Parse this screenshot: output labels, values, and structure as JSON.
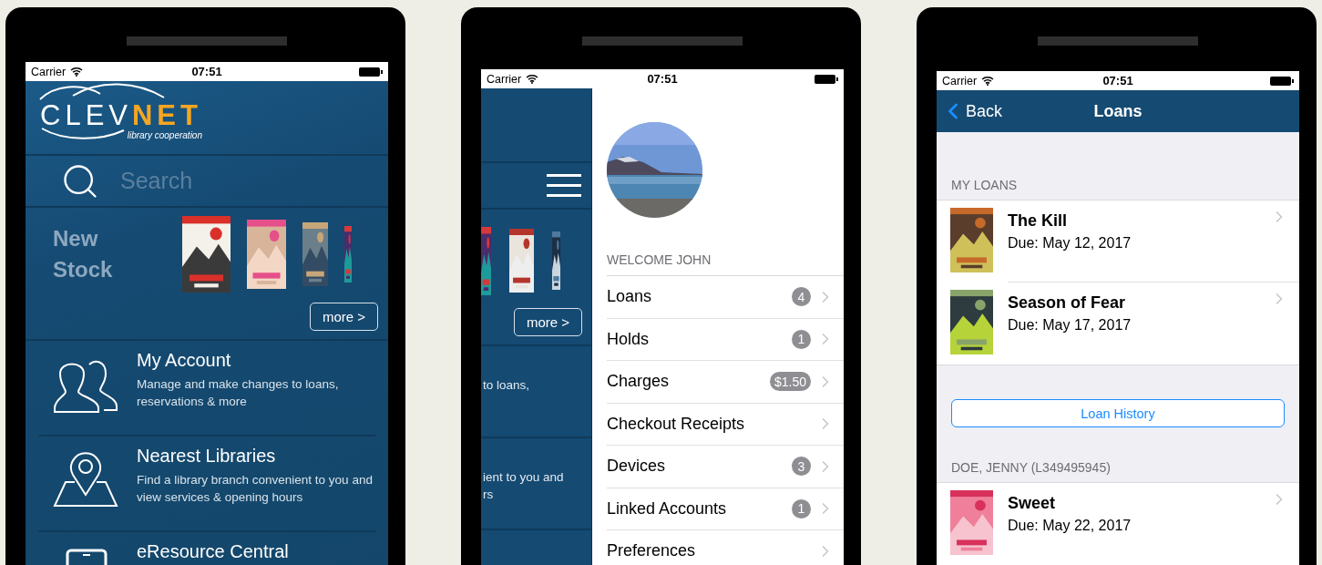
{
  "phones": [
    {
      "kind": "home",
      "status": {
        "carrier": "Carrier",
        "time": "07:51"
      },
      "logo": {
        "main": "CLEV",
        "accent": "NET",
        "tagline": "library cooperation"
      },
      "search": {
        "placeholder": "Search"
      },
      "new_stock": {
        "title": "New Stock",
        "more": "more >"
      },
      "menu": [
        {
          "title": "My Account",
          "description": "Manage and make changes to loans, reservations & more"
        },
        {
          "title": "Nearest Libraries",
          "description": "Find a library branch convenient to you and view services & opening hours"
        },
        {
          "title": "eResource Central"
        }
      ]
    },
    {
      "kind": "drawer",
      "status": {
        "carrier": "Carrier",
        "time": "07:51"
      },
      "behind": {
        "more": "more >",
        "first_lines": [
          "to loans,"
        ],
        "second_lines": [
          "ient to you and",
          "rs"
        ]
      },
      "welcome": "WELCOME JOHN",
      "items": [
        {
          "label": "Loans",
          "badge": "4"
        },
        {
          "label": "Holds",
          "badge": "1"
        },
        {
          "label": "Charges",
          "badge": "$1.50"
        },
        {
          "label": "Checkout Receipts"
        },
        {
          "label": "Devices",
          "badge": "3"
        },
        {
          "label": "Linked Accounts",
          "badge": "1"
        },
        {
          "label": "Preferences"
        }
      ]
    },
    {
      "kind": "loans",
      "status": {
        "carrier": "Carrier",
        "time": "07:51"
      },
      "nav": {
        "back": "Back",
        "title": "Loans"
      },
      "my_loans": {
        "header": "MY LOANS",
        "items": [
          {
            "title": "The Kill",
            "due": "Due: May 12, 2017"
          },
          {
            "title": "Season of Fear",
            "due": "Due: May 17, 2017"
          }
        ]
      },
      "history_button": "Loan History",
      "linked": {
        "header": "DOE, JENNY (L349495945)",
        "items": [
          {
            "title": "Sweet",
            "due": "Due: May 22, 2017"
          }
        ]
      }
    }
  ]
}
